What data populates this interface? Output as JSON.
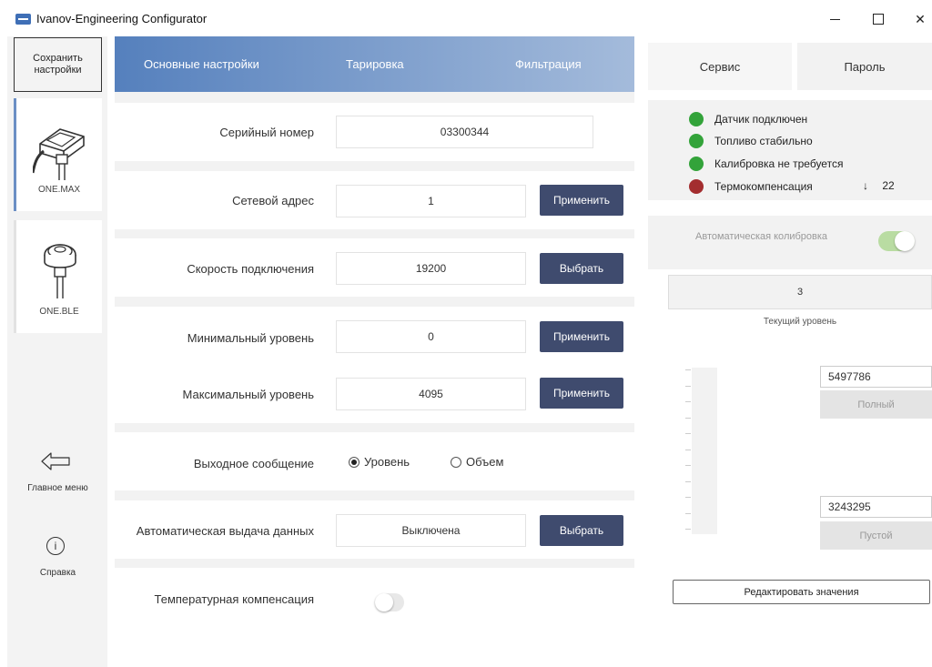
{
  "window": {
    "title": "Ivanov-Engineering Configurator",
    "min": "",
    "max": "",
    "close": "✕"
  },
  "sidebar": {
    "save_button": "Сохранить\nнастройки",
    "devices": [
      {
        "label": "ONE.MAX",
        "selected": true
      },
      {
        "label": "ONE.BLE",
        "selected": false
      }
    ],
    "main_menu": "Главное меню",
    "help": "Справка",
    "help_icon": "i"
  },
  "tabs": {
    "main": "Основные настройки",
    "tare": "Тарировка",
    "filter": "Фильтрация"
  },
  "settings": {
    "serial": {
      "label": "Серийный номер",
      "value": "03300344"
    },
    "address": {
      "label": "Сетевой адрес",
      "value": "1",
      "button": "Применить"
    },
    "speed": {
      "label": "Скорость подключения",
      "value": "19200",
      "button": "Выбрать"
    },
    "min_level": {
      "label": "Минимальный уровень",
      "value": "0",
      "button": "Применить"
    },
    "max_level": {
      "label": "Максимальный уровень",
      "value": "4095",
      "button": "Применить"
    },
    "output": {
      "label": "Выходное сообщение",
      "option_level": "Уровень",
      "option_volume": "Объем",
      "selected": "Уровень"
    },
    "auto_data": {
      "label": "Автоматическая выдача данных",
      "value": "Выключена",
      "button": "Выбрать"
    },
    "temp_comp": {
      "label": "Температурная компенсация",
      "enabled": false
    }
  },
  "right": {
    "service_tab": "Сервис",
    "password_tab": "Пароль",
    "statuses": [
      {
        "label": "Датчик подключен",
        "color": "#33a33a"
      },
      {
        "label": "Топливо стабильно",
        "color": "#33a33a"
      },
      {
        "label": "Калибровка не требуется",
        "color": "#33a33a"
      },
      {
        "label": "Термокомпенсация",
        "color": "#a32d2f"
      }
    ],
    "temperature_arrow": "↓",
    "temperature": "22",
    "auto_calibration": {
      "label": "Автоматическая колибровка",
      "enabled": true
    },
    "current_level": {
      "value": "3",
      "caption": "Текущий уровень"
    },
    "full": {
      "value": "5497786",
      "button": "Полный"
    },
    "empty": {
      "value": "3243295",
      "button": "Пустой"
    },
    "edit_button": "Редактировать значения"
  }
}
